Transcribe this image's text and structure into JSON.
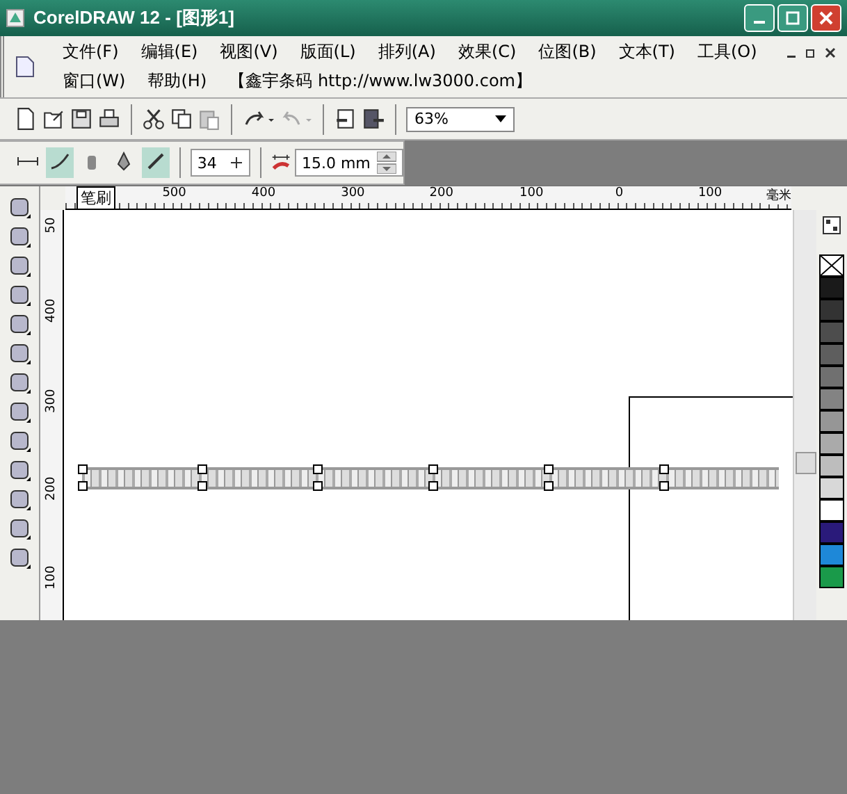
{
  "window": {
    "title": "CorelDRAW 12 - [图形1]"
  },
  "menu_rows": [
    [
      {
        "label": "文件(F)"
      },
      {
        "label": "编辑(E)"
      },
      {
        "label": "视图(V)"
      },
      {
        "label": "版面(L)"
      },
      {
        "label": "排列(A)"
      },
      {
        "label": "效果(C)"
      },
      {
        "label": "位图(B)"
      },
      {
        "label": "文本(T)"
      },
      {
        "label": "工具(O)"
      }
    ],
    [
      {
        "label": "窗口(W)"
      },
      {
        "label": "帮助(H)"
      },
      {
        "label": "【鑫宇条码  http://www.lw3000.com】"
      }
    ]
  ],
  "standard_toolbar": {
    "zoom": "63%"
  },
  "brush_toolbar": {
    "modes": [
      {
        "selected": false
      },
      {
        "selected": true
      },
      {
        "selected": false
      },
      {
        "selected": false
      },
      {
        "selected": true
      }
    ],
    "size": "34",
    "width": "15.0 mm"
  },
  "rulers": {
    "corner_label": "笔刷",
    "unit": "毫米",
    "horizontal": [
      "500",
      "400",
      "300",
      "200",
      "100",
      "0",
      "100"
    ],
    "vertical": [
      "50",
      "400",
      "300",
      "200",
      "100"
    ]
  },
  "palette": [
    {
      "kind": "none"
    },
    {
      "kind": "swatch",
      "color": "#1a1a1a"
    },
    {
      "kind": "swatch",
      "color": "#333333"
    },
    {
      "kind": "swatch",
      "color": "#4d4d4d"
    },
    {
      "kind": "swatch",
      "color": "#5e5e5e"
    },
    {
      "kind": "swatch",
      "color": "#707070"
    },
    {
      "kind": "swatch",
      "color": "#838383"
    },
    {
      "kind": "swatch",
      "color": "#969696"
    },
    {
      "kind": "swatch",
      "color": "#aaaaaa"
    },
    {
      "kind": "swatch",
      "color": "#bdbdbd"
    },
    {
      "kind": "swatch",
      "color": "#d8d8d8"
    },
    {
      "kind": "swatch",
      "color": "#ffffff"
    },
    {
      "kind": "swatch",
      "color": "#2a1a7a"
    },
    {
      "kind": "swatch",
      "color": "#1e88d8"
    },
    {
      "kind": "swatch",
      "color": "#1a9a4a"
    }
  ]
}
